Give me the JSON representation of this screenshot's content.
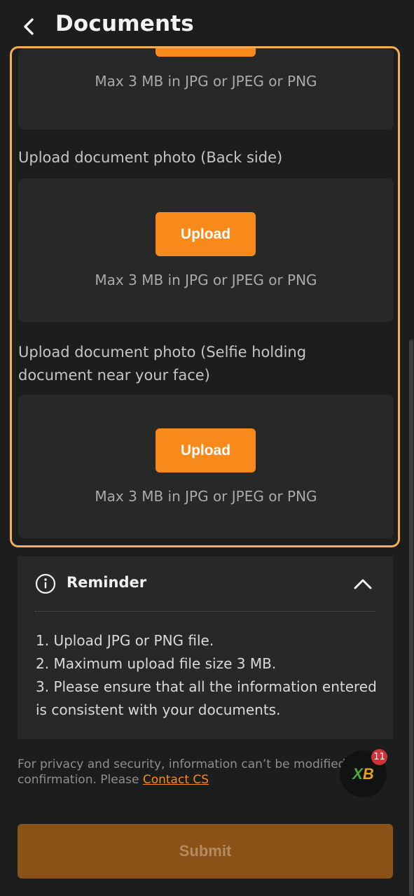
{
  "header": {
    "title": "Documents",
    "back_icon": "chevron-left-icon"
  },
  "upload_section": {
    "front": {
      "hint": "Max 3 MB in JPG or JPEG or PNG"
    },
    "back": {
      "label": "Upload document photo (Back side)",
      "button_label": "Upload",
      "hint": "Max 3 MB in JPG or JPEG or PNG"
    },
    "selfie": {
      "label": "Upload document photo (Selfie holding document near your face)",
      "button_label": "Upload",
      "hint": "Max 3 MB in JPG or JPEG or PNG"
    }
  },
  "reminder": {
    "title": "Reminder",
    "icon": "info-icon",
    "toggle_icon": "chevron-up-icon",
    "items": [
      "1. Upload JPG or PNG file.",
      "2. Maximum upload file size 3 MB.",
      "3. Please ensure that all the information entered is consistent with your documents."
    ]
  },
  "privacy": {
    "text": "For privacy and security, information can’t be modified after confirmation. Please ",
    "link_text": "Contact CS"
  },
  "chat": {
    "badge_count": "11",
    "logo_text_a": "X",
    "logo_text_b": "B"
  },
  "submit": {
    "label": "Submit"
  },
  "colors": {
    "accent": "#f8891b",
    "highlight_border": "#f6ad55",
    "submit_disabled": "#8a5217",
    "card_bg": "#272929",
    "page_bg": "#1c1d1d"
  }
}
